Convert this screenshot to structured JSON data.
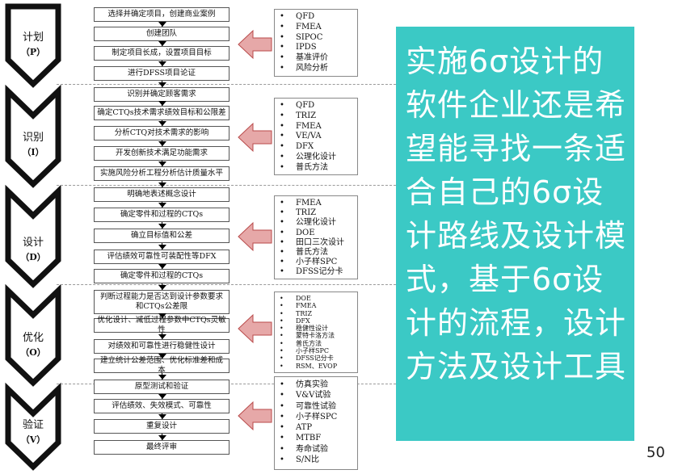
{
  "phases": [
    {
      "name": "计划",
      "code": "（P）"
    },
    {
      "name": "识别",
      "code": "（I）"
    },
    {
      "name": "设计",
      "code": "（D）"
    },
    {
      "name": "优化",
      "code": "（O）"
    },
    {
      "name": "验证",
      "code": "（V）"
    }
  ],
  "steps": [
    "选择并确定项目，创建商业案例",
    "创建团队",
    "制定项目长成，设置项目目标",
    "进行DFSS项目论证",
    "识别并确定顾客需求",
    "确定CTQs技术需求绩效目标和公限差",
    "分析CTQ对技术需求的影响",
    "开发创新技术满足功能需求",
    "实施风险分析工程分析估计质量水平",
    "明确地表述概念设计",
    "确定零件和过程的CTQs",
    "确立目标值和公差",
    "评估绩效可靠性可装配性等DFX",
    "确定零件和过程的CTQs",
    "判断过程能力是否达到设计参数要求和CTQs公差限",
    "优化设计、减低过程参数中CTQs灵敏性",
    "对绩效和可靠性进行稳健性设计",
    "建立统计公差范围、优化标准差和成本",
    "原型测试和验证",
    "评估绩效、失效模式、可靠性",
    "重复设计",
    "最终评审"
  ],
  "tools": [
    [
      "QFD",
      "FMEA",
      "SIPOC",
      "IPDS",
      "基准评价",
      "风险分析"
    ],
    [
      "QFD",
      "TRIZ",
      "FMEA",
      "VE/VA",
      "DFX",
      "公理化设计",
      "普氏方法"
    ],
    [
      "FMEA",
      "TRIZ",
      "公理化设计",
      "DOE",
      "田口三次设计",
      "普氏方法",
      "小子样SPC",
      "DFSS记分卡"
    ],
    [
      "DOE",
      "FMEA",
      "TRIZ",
      "DFX",
      "稳健性设计",
      "蒙特卡洛方法",
      "普氏方法",
      "小子样SPC",
      "DFSS记分卡",
      "RSM、EVOP"
    ],
    [
      "仿真实验",
      "V&V试验",
      "可靠性试验",
      "小子样SPC",
      "ATP",
      "MTBF",
      "寿命试验",
      "S/N比"
    ]
  ],
  "summary_text": "实施6σ设计的软件企业还是希望能寻找一条适合自己的6σ设计路线及设计模式，基于6σ设计的流程，设计方法及设计工具",
  "page_number": "50",
  "colors": {
    "textbox_bg": "#3bc9c5",
    "arrow_fill": "#e6a8a8",
    "arrow_stroke": "#b94a4a",
    "chevron_fill": "#ffffff",
    "chevron_stroke": "#111111"
  }
}
